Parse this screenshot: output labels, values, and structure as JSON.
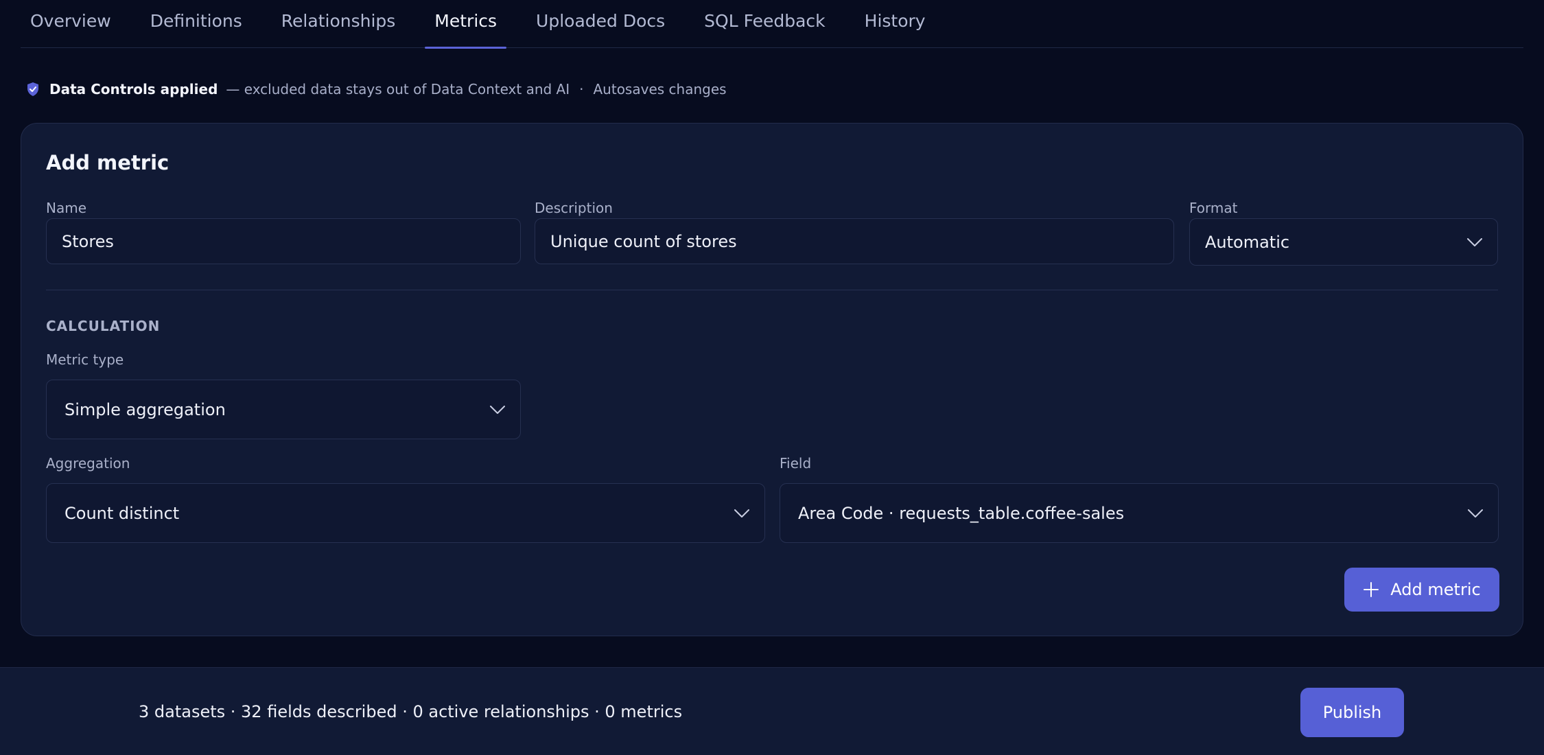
{
  "tabs": [
    {
      "label": "Overview"
    },
    {
      "label": "Definitions"
    },
    {
      "label": "Relationships"
    },
    {
      "label": "Metrics",
      "active": true
    },
    {
      "label": "Uploaded Docs"
    },
    {
      "label": "SQL Feedback"
    },
    {
      "label": "History"
    }
  ],
  "info": {
    "icon": "shield-check-icon",
    "title": "Data Controls applied",
    "detail": "— excluded data stays out of Data Context and AI",
    "separator": "·",
    "autosave": "Autosaves changes"
  },
  "form": {
    "title": "Add metric",
    "name": {
      "label": "Name",
      "value": "Stores"
    },
    "description": {
      "label": "Description",
      "value": "Unique count of stores"
    },
    "format": {
      "label": "Format",
      "value": "Automatic"
    },
    "section": "CALCULATION",
    "metric_type": {
      "label": "Metric type",
      "value": "Simple aggregation"
    },
    "aggregation": {
      "label": "Aggregation",
      "value": "Count distinct"
    },
    "field": {
      "label": "Field",
      "value": "Area Code · requests_table.coffee-sales"
    },
    "add_button": "Add metric"
  },
  "footer": {
    "summary": "3 datasets · 32 fields described · 0 active relationships · 0 metrics",
    "publish_button": "Publish"
  },
  "colors": {
    "background": "#070c1f",
    "card": "#111a35",
    "accent": "#5660d6",
    "border": "#263051"
  }
}
